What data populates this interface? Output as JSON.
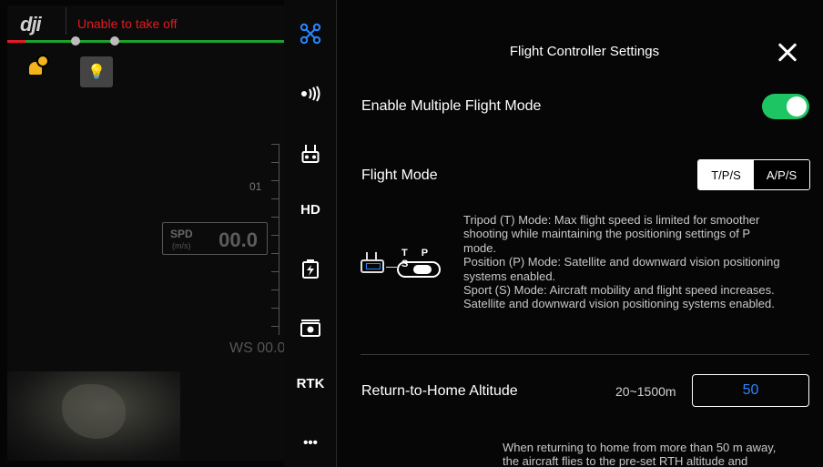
{
  "hud": {
    "logo": "dji",
    "status": "Unable to take off",
    "scale_value": "01",
    "speed_label": "SPD",
    "speed_unit": "(m/s)",
    "speed_value": "00.0",
    "wind_speed": "WS 00.0"
  },
  "iconbar": {
    "hd_label": "HD",
    "rtk_label": "RTK",
    "more_label": "•••"
  },
  "panel": {
    "title": "Flight Controller Settings",
    "multiple_mode_label": "Enable Multiple Flight Mode",
    "multiple_mode_enabled": true,
    "flight_mode_label": "Flight Mode",
    "flight_mode_options": [
      "T/P/S",
      "A/P/S"
    ],
    "flight_mode_selected": "T/P/S",
    "switch_letters": "T P S",
    "mode_desc": [
      "Tripod (T) Mode: Max flight speed is limited for smoother",
      "shooting while maintaining the positioning settings of P",
      "mode.",
      "Position (P) Mode: Satellite and downward vision positioning",
      "systems enabled.",
      "Sport (S) Mode: Aircraft mobility and flight speed increases.",
      "Satellite and downward vision positioning systems enabled."
    ],
    "rth_label": "Return-to-Home Altitude",
    "rth_range": "20~1500m",
    "rth_value": "50",
    "rth_desc": [
      "When returning to home from more than 50 m away,",
      "the aircraft flies to the pre-set RTH altitude and"
    ]
  },
  "colors": {
    "accent": "#2a86ff",
    "toggle_on": "#1dc563",
    "status_red": "#e31b22",
    "progress_green": "#1fa12c"
  }
}
